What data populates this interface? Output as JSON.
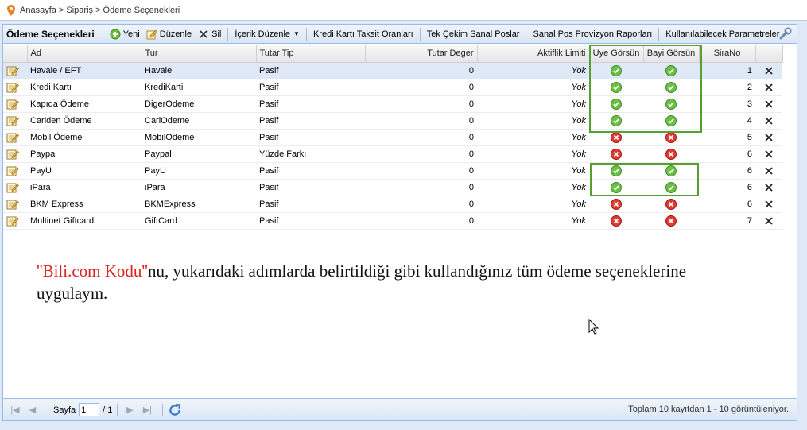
{
  "breadcrumb": {
    "text": "Anasayfa > Sipariş > Ödeme Seçenekleri"
  },
  "toolbar": {
    "title": "Ödeme Seçenekleri",
    "new_label": "Yeni",
    "edit_label": "Düzenle",
    "delete_label": "Sil",
    "content_edit_label": "İçerik Düzenle",
    "installments_label": "Kredi Kartı Taksit Oranları",
    "single_pos_label": "Tek Çekim Sanal Poslar",
    "pos_report_label": "Sanal Pos Provizyon Raporları",
    "params_label": "Kullanılabilecek Parametreler"
  },
  "columns": {
    "ad": "Ad",
    "tur": "Tur",
    "tutar_tip": "Tutar Tip",
    "tutar_deger": "Tutar Deger",
    "aktiflik_limiti": "Aktiflik Limiti",
    "uye_gorsun": "Uye Görsün",
    "bayi_gorsun": "Bayi Görsün",
    "sirano": "SiraNo"
  },
  "rows": [
    {
      "ad": "Havale / EFT",
      "tur": "Havale",
      "tutar_tip": "Pasif",
      "tutar_deger": "0",
      "limit": "Yok",
      "uye": true,
      "bayi": true,
      "sirano": "1"
    },
    {
      "ad": "Kredi Kartı",
      "tur": "KrediKarti",
      "tutar_tip": "Pasif",
      "tutar_deger": "0",
      "limit": "Yok",
      "uye": true,
      "bayi": true,
      "sirano": "2"
    },
    {
      "ad": "Kapıda Ödeme",
      "tur": "DigerOdeme",
      "tutar_tip": "Pasif",
      "tutar_deger": "0",
      "limit": "Yok",
      "uye": true,
      "bayi": true,
      "sirano": "3"
    },
    {
      "ad": "Cariden Ödeme",
      "tur": "CariOdeme",
      "tutar_tip": "Pasif",
      "tutar_deger": "0",
      "limit": "Yok",
      "uye": true,
      "bayi": true,
      "sirano": "4"
    },
    {
      "ad": "Mobil Ödeme",
      "tur": "MobilOdeme",
      "tutar_tip": "Pasif",
      "tutar_deger": "0",
      "limit": "Yok",
      "uye": false,
      "bayi": false,
      "sirano": "5"
    },
    {
      "ad": "Paypal",
      "tur": "Paypal",
      "tutar_tip": "Yüzde Farkı",
      "tutar_deger": "0",
      "limit": "Yok",
      "uye": false,
      "bayi": false,
      "sirano": "6"
    },
    {
      "ad": "PayU",
      "tur": "PayU",
      "tutar_tip": "Pasif",
      "tutar_deger": "0",
      "limit": "Yok",
      "uye": true,
      "bayi": true,
      "sirano": "6"
    },
    {
      "ad": "iPara",
      "tur": "iPara",
      "tutar_tip": "Pasif",
      "tutar_deger": "0",
      "limit": "Yok",
      "uye": true,
      "bayi": true,
      "sirano": "6"
    },
    {
      "ad": "BKM Express",
      "tur": "BKMExpress",
      "tutar_tip": "Pasif",
      "tutar_deger": "0",
      "limit": "Yok",
      "uye": false,
      "bayi": false,
      "sirano": "6"
    },
    {
      "ad": "Multinet Giftcard",
      "tur": "GiftCard",
      "tutar_tip": "Pasif",
      "tutar_deger": "0",
      "limit": "Yok",
      "uye": false,
      "bayi": false,
      "sirano": "7"
    }
  ],
  "note": {
    "highlight": "''Bili.com Kodu''",
    "text": "nu, yukarıdaki adımlarda belirtildiği gibi kullandığınız tüm ödeme seçeneklerine uygulayın."
  },
  "pager": {
    "page_label": "Sayfa",
    "page_value": "1",
    "page_total": "/ 1",
    "status": "Toplam 10 kayıtdan 1 - 10 görüntüleniyor."
  },
  "icons": {
    "check": "check-circle-icon",
    "cross": "red-x-icon",
    "delete": "close-icon",
    "edit": "edit-icon",
    "add": "add-icon",
    "refresh": "refresh-icon",
    "wrench": "wrench-icon"
  },
  "colors": {
    "highlight_box": "#55a030",
    "note_red": "#e02020",
    "selected_row": "#dfe8f6",
    "panel_border": "#99bbe8"
  }
}
